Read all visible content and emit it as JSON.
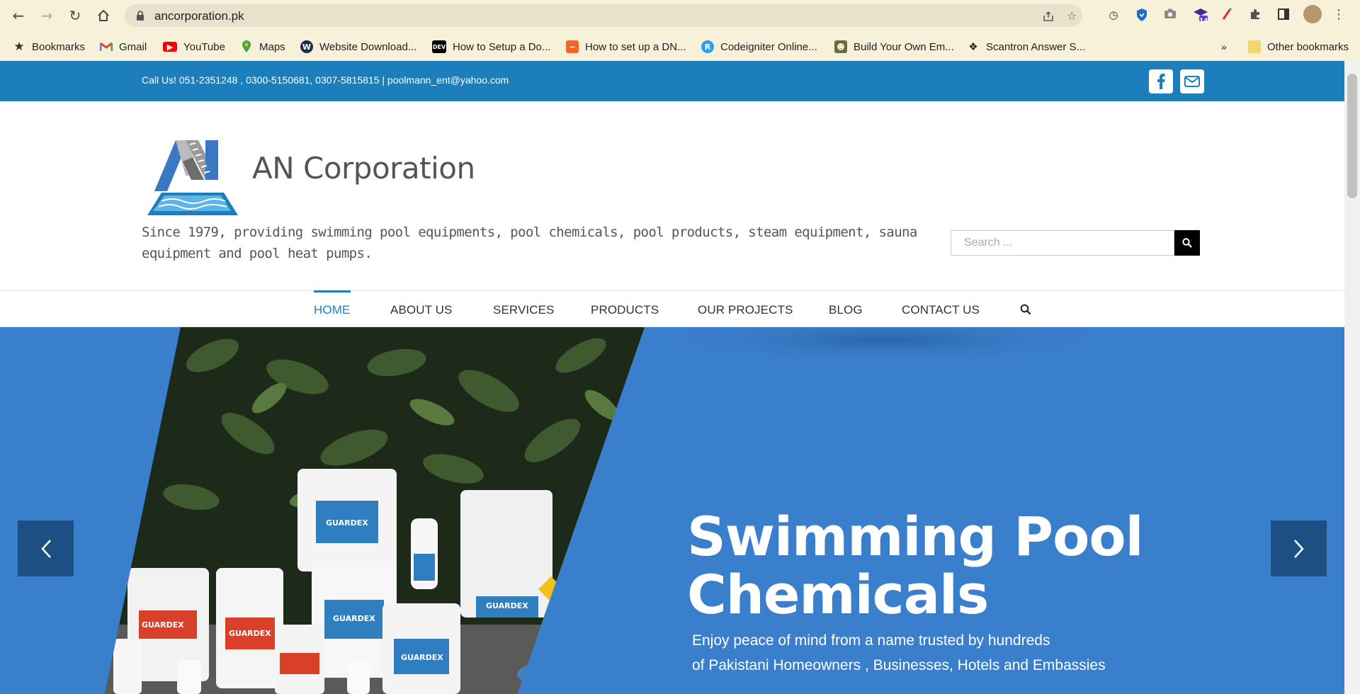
{
  "browser": {
    "url": "ancorporation.pk",
    "extension_badge": "14",
    "bookmarks": [
      {
        "label": "Bookmarks",
        "icon": "star-icon"
      },
      {
        "label": "Gmail",
        "icon": "gmail-icon"
      },
      {
        "label": "YouTube",
        "icon": "youtube-icon"
      },
      {
        "label": "Maps",
        "icon": "maps-icon"
      },
      {
        "label": "Website Download...",
        "icon": "w-icon"
      },
      {
        "label": "How to Setup a Do...",
        "icon": "dev-icon"
      },
      {
        "label": "How to set up a DN...",
        "icon": "bookmark-site-icon"
      },
      {
        "label": "Codeigniter Online...",
        "icon": "r-icon"
      },
      {
        "label": "Build Your Own Em...",
        "icon": "avatar-icon"
      },
      {
        "label": "Scantron Answer S...",
        "icon": "codepen-icon"
      }
    ],
    "overflow_label": "»",
    "other_bookmarks": "Other bookmarks"
  },
  "topbar": {
    "contact": "Call Us! 051-2351248 , 0300-5150681, 0307-5815815  |  poolmann_ent@yahoo.com"
  },
  "header": {
    "company_name": "AN Corporation",
    "tagline": "Since 1979, providing swimming pool equipments, pool chemicals, pool products, steam equipment, sauna equipment and pool heat pumps.",
    "search_placeholder": "Search ..."
  },
  "nav": {
    "items": [
      "HOME",
      "ABOUT US",
      "SERVICES",
      "PRODUCTS",
      "OUR PROJECTS",
      "BLOG",
      "CONTACT US"
    ],
    "active": "HOME"
  },
  "hero": {
    "title_line1": "Swimming Pool",
    "title_line2": "Chemicals",
    "subtitle_line1": "Enjoy peace of mind from a name trusted by hundreds",
    "subtitle_line2": "of Pakistani Homeowners , Businesses, Hotels and Embassies",
    "product_brand": "GUARDEX"
  },
  "colors": {
    "chrome": "#f7f1d9",
    "topbar": "#1c7fbb",
    "hero": "#3a7fcc",
    "slider_arrow": "#1e4f83"
  }
}
